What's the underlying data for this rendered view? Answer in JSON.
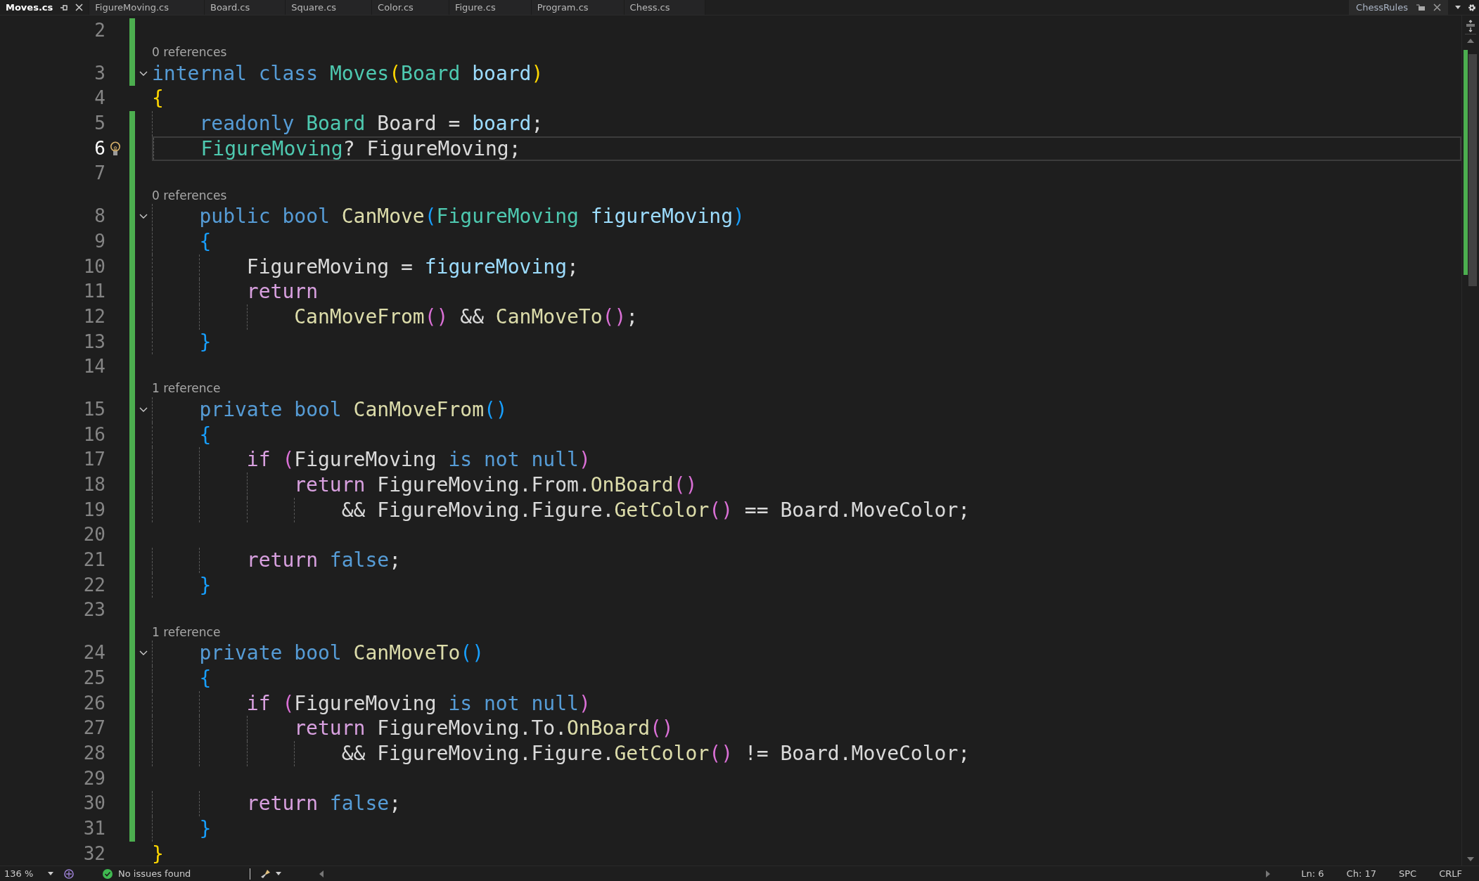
{
  "tabs": [
    {
      "label": "Moves.cs",
      "selected": true
    },
    {
      "label": "FigureMoving.cs",
      "selected": false
    },
    {
      "label": "Board.cs",
      "selected": false
    },
    {
      "label": "Square.cs",
      "selected": false
    },
    {
      "label": "Color.cs",
      "selected": false
    },
    {
      "label": "Figure.cs",
      "selected": false
    },
    {
      "label": "Program.cs",
      "selected": false
    },
    {
      "label": "Chess.cs",
      "selected": false
    }
  ],
  "project_tab": {
    "label": "ChessRules"
  },
  "lines": [
    {
      "n": "2",
      "changed": true,
      "current": false
    },
    {
      "n": "3",
      "changed": true,
      "current": false,
      "lens": "0 references",
      "expanded": true,
      "tokens": [
        {
          "text": "internal class ",
          "kind": "kw"
        },
        {
          "text": "Moves",
          "kind": "type"
        },
        {
          "text": "(",
          "kind": "b1"
        },
        {
          "text": "Board ",
          "kind": "type"
        },
        {
          "text": "board",
          "kind": "param"
        },
        {
          "text": ")",
          "kind": "b1"
        }
      ]
    },
    {
      "n": "4",
      "changed": false,
      "current": false,
      "tokens": [
        {
          "text": "{",
          "kind": "b1"
        }
      ]
    },
    {
      "n": "5",
      "changed": true,
      "current": false,
      "tokens": [
        {
          "text": "    readonly ",
          "kind": "kw"
        },
        {
          "text": "Board ",
          "kind": "type"
        },
        {
          "text": "Board = ",
          "kind": "p"
        },
        {
          "text": "board",
          "kind": "param"
        },
        {
          "text": ";",
          "kind": "p"
        }
      ]
    },
    {
      "n": "6",
      "changed": true,
      "current": true,
      "hint": true,
      "tokens": [
        {
          "text": "    FigureMoving",
          "kind": "type"
        },
        {
          "text": "? FigureMoving;",
          "kind": "p"
        }
      ]
    },
    {
      "n": "7",
      "changed": true,
      "current": false
    },
    {
      "n": "8",
      "changed": true,
      "current": false,
      "lens": "0 references",
      "expanded": true,
      "tokens": [
        {
          "text": "    public bool ",
          "kind": "kw"
        },
        {
          "text": "CanMove",
          "kind": "method"
        },
        {
          "text": "(",
          "kind": "b2"
        },
        {
          "text": "FigureMoving ",
          "kind": "type"
        },
        {
          "text": "figureMoving",
          "kind": "param"
        },
        {
          "text": ")",
          "kind": "b2"
        }
      ]
    },
    {
      "n": "9",
      "changed": true,
      "current": false,
      "tokens": [
        {
          "text": "    {",
          "kind": "b2"
        }
      ]
    },
    {
      "n": "10",
      "changed": true,
      "current": false,
      "tokens": [
        {
          "text": "        FigureMoving = ",
          "kind": "p"
        },
        {
          "text": "figureMoving",
          "kind": "param"
        },
        {
          "text": ";",
          "kind": "p"
        }
      ]
    },
    {
      "n": "11",
      "changed": true,
      "current": false,
      "tokens": [
        {
          "text": "        return",
          "kind": "ctrl"
        }
      ]
    },
    {
      "n": "12",
      "changed": true,
      "current": false,
      "tokens": [
        {
          "text": "            CanMoveFrom",
          "kind": "method"
        },
        {
          "text": "()",
          "kind": "b3"
        },
        {
          "text": " && ",
          "kind": "p"
        },
        {
          "text": "CanMoveTo",
          "kind": "method"
        },
        {
          "text": "()",
          "kind": "b3"
        },
        {
          "text": ";",
          "kind": "p"
        }
      ]
    },
    {
      "n": "13",
      "changed": true,
      "current": false,
      "tokens": [
        {
          "text": "    }",
          "kind": "b2"
        }
      ]
    },
    {
      "n": "14",
      "changed": true,
      "current": false
    },
    {
      "n": "15",
      "changed": true,
      "current": false,
      "lens": "1 reference",
      "expanded": true,
      "tokens": [
        {
          "text": "    private bool ",
          "kind": "kw"
        },
        {
          "text": "CanMoveFrom",
          "kind": "method"
        },
        {
          "text": "()",
          "kind": "b2"
        }
      ]
    },
    {
      "n": "16",
      "changed": true,
      "current": false,
      "tokens": [
        {
          "text": "    {",
          "kind": "b2"
        }
      ]
    },
    {
      "n": "17",
      "changed": true,
      "current": false,
      "tokens": [
        {
          "text": "        if ",
          "kind": "ctrl"
        },
        {
          "text": "(",
          "kind": "b3"
        },
        {
          "text": "FigureMoving ",
          "kind": "p"
        },
        {
          "text": "is not null",
          "kind": "kw"
        },
        {
          "text": ")",
          "kind": "b3"
        }
      ]
    },
    {
      "n": "18",
      "changed": true,
      "current": false,
      "tokens": [
        {
          "text": "            return ",
          "kind": "ctrl"
        },
        {
          "text": "FigureMoving.From.",
          "kind": "p"
        },
        {
          "text": "OnBoard",
          "kind": "method"
        },
        {
          "text": "()",
          "kind": "b3"
        }
      ]
    },
    {
      "n": "19",
      "changed": true,
      "current": false,
      "tokens": [
        {
          "text": "                && FigureMoving.Figure.",
          "kind": "p"
        },
        {
          "text": "GetColor",
          "kind": "method"
        },
        {
          "text": "()",
          "kind": "b3"
        },
        {
          "text": " == Board.MoveColor;",
          "kind": "p"
        }
      ]
    },
    {
      "n": "20",
      "changed": true,
      "current": false
    },
    {
      "n": "21",
      "changed": true,
      "current": false,
      "tokens": [
        {
          "text": "        return ",
          "kind": "ctrl"
        },
        {
          "text": "false",
          "kind": "kw"
        },
        {
          "text": ";",
          "kind": "p"
        }
      ]
    },
    {
      "n": "22",
      "changed": true,
      "current": false,
      "tokens": [
        {
          "text": "    }",
          "kind": "b2"
        }
      ]
    },
    {
      "n": "23",
      "changed": true,
      "current": false
    },
    {
      "n": "24",
      "changed": true,
      "current": false,
      "lens": "1 reference",
      "expanded": true,
      "tokens": [
        {
          "text": "    private bool ",
          "kind": "kw"
        },
        {
          "text": "CanMoveTo",
          "kind": "method"
        },
        {
          "text": "()",
          "kind": "b2"
        }
      ]
    },
    {
      "n": "25",
      "changed": true,
      "current": false,
      "tokens": [
        {
          "text": "    {",
          "kind": "b2"
        }
      ]
    },
    {
      "n": "26",
      "changed": true,
      "current": false,
      "tokens": [
        {
          "text": "        if ",
          "kind": "ctrl"
        },
        {
          "text": "(",
          "kind": "b3"
        },
        {
          "text": "FigureMoving ",
          "kind": "p"
        },
        {
          "text": "is not null",
          "kind": "kw"
        },
        {
          "text": ")",
          "kind": "b3"
        }
      ]
    },
    {
      "n": "27",
      "changed": true,
      "current": false,
      "tokens": [
        {
          "text": "            return ",
          "kind": "ctrl"
        },
        {
          "text": "FigureMoving.To.",
          "kind": "p"
        },
        {
          "text": "OnBoard",
          "kind": "method"
        },
        {
          "text": "()",
          "kind": "b3"
        }
      ]
    },
    {
      "n": "28",
      "changed": true,
      "current": false,
      "tokens": [
        {
          "text": "                && FigureMoving.Figure.",
          "kind": "p"
        },
        {
          "text": "GetColor",
          "kind": "method"
        },
        {
          "text": "()",
          "kind": "b3"
        },
        {
          "text": " != Board.MoveColor;",
          "kind": "p"
        }
      ]
    },
    {
      "n": "29",
      "changed": true,
      "current": false
    },
    {
      "n": "30",
      "changed": true,
      "current": false,
      "tokens": [
        {
          "text": "        return ",
          "kind": "ctrl"
        },
        {
          "text": "false",
          "kind": "kw"
        },
        {
          "text": ";",
          "kind": "p"
        }
      ]
    },
    {
      "n": "31",
      "changed": true,
      "current": false,
      "tokens": [
        {
          "text": "    }",
          "kind": "b2"
        }
      ]
    },
    {
      "n": "32",
      "changed": false,
      "current": false,
      "tokens": [
        {
          "text": "}",
          "kind": "b1"
        }
      ]
    }
  ],
  "status_bar": {
    "zoom": "136 %",
    "issues": "No issues found",
    "line": "Ln: 6",
    "column": "Ch: 17",
    "indent": "SPC",
    "line_ending": "CRLF"
  }
}
